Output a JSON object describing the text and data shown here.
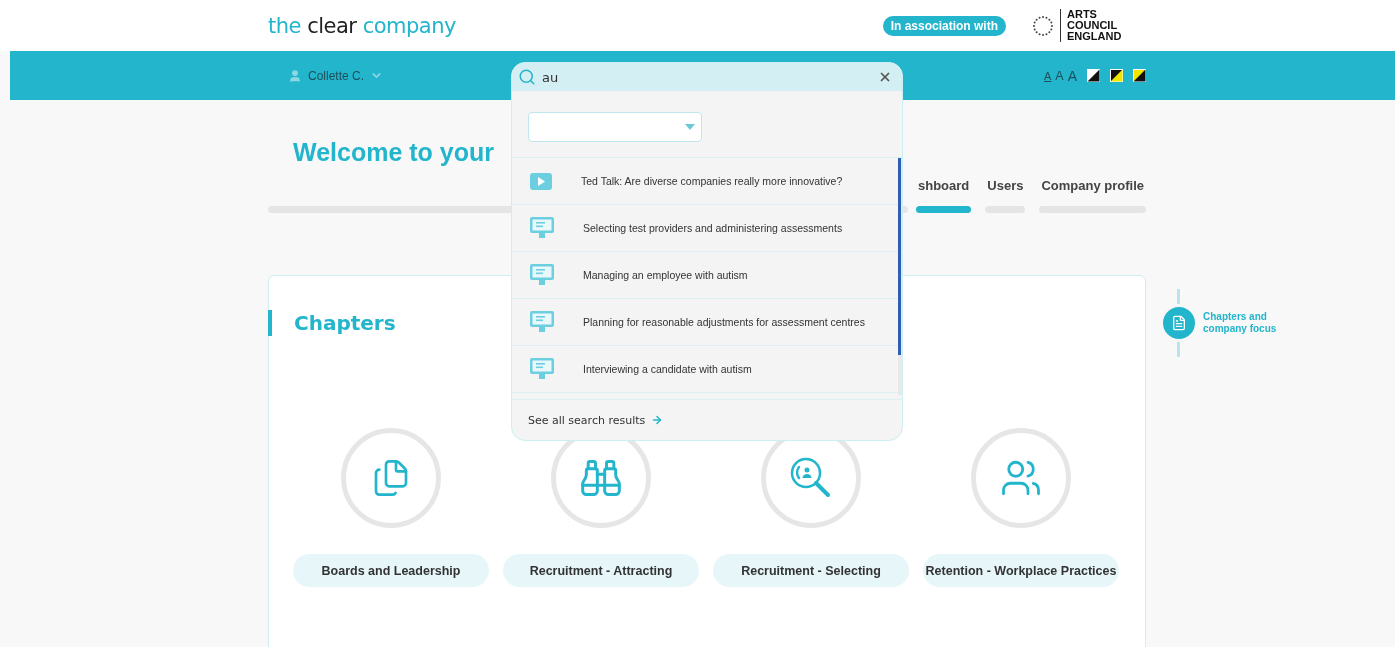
{
  "header": {
    "logo_words": [
      "the",
      "clear",
      "company"
    ],
    "association_badge": "In association with",
    "partner": "ARTS COUNCIL ENGLAND"
  },
  "nav_bar": {
    "user": "Collette C.",
    "text_sizes": [
      {
        "label": "A",
        "selected": true
      },
      {
        "label": "A",
        "selected": false
      },
      {
        "label": "A",
        "selected": false
      }
    ]
  },
  "search": {
    "value": "au",
    "results": [
      {
        "kind": "video",
        "title": "Ted Talk: Are diverse companies really more innovative?"
      },
      {
        "kind": "presentation",
        "title": "Selecting test providers and administering assessments"
      },
      {
        "kind": "presentation",
        "title": "Managing an employee with autism"
      },
      {
        "kind": "presentation",
        "title": "Planning for reasonable adjustments for assessment centres"
      },
      {
        "kind": "presentation",
        "title": "Interviewing a candidate with autism"
      }
    ],
    "see_all": "See all search results"
  },
  "page_title": "Welcome to your",
  "tabs": [
    {
      "label": "shboard",
      "selected": true
    },
    {
      "label": "Users",
      "selected": false
    },
    {
      "label": "Company profile",
      "selected": false
    }
  ],
  "chapters": {
    "title": "Chapters",
    "items": [
      {
        "label": "Boards and Leadership"
      },
      {
        "label": "Recruitment - Attracting"
      },
      {
        "label": "Recruitment - Selecting"
      },
      {
        "label": "Retention - Workplace Practices"
      }
    ]
  },
  "side_nav": {
    "items": [
      {
        "label": "Chapters and company focus",
        "selected": true
      }
    ]
  }
}
